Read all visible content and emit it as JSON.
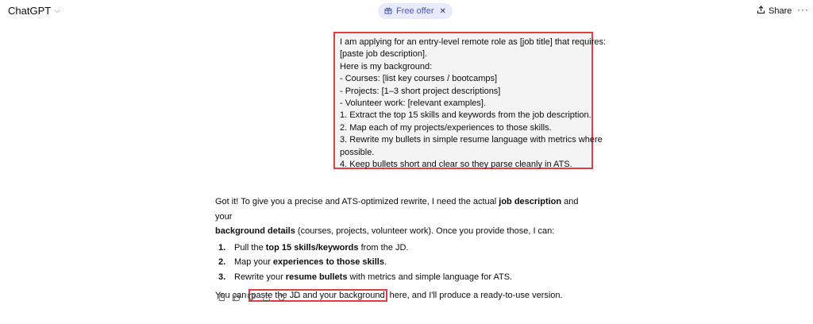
{
  "header": {
    "model_name": "ChatGPT",
    "offer_label": "Free offer",
    "share_label": "Share"
  },
  "user_message": {
    "lines": [
      "I am applying for an entry-level remote role as [job title] that requires:",
      "[paste job description].",
      "Here is my background:",
      "- Courses: [list key courses / bootcamps]",
      "- Projects: [1–3 short project descriptions]",
      "- Volunteer work: [relevant examples].",
      "1. Extract the top 15 skills and keywords from the job description.",
      "2. Map each of my projects/experiences to those skills.",
      "3. Rewrite my bullets in simple resume language with metrics where",
      "possible.",
      "4. Keep bullets short and clear so they parse cleanly in ATS."
    ]
  },
  "assistant": {
    "intro_1": "Got it! To give you a precise and ATS-optimized rewrite, I need the actual ",
    "intro_bold_1": "job description",
    "intro_2": " and your",
    "intro_bold_2": "background details",
    "intro_3": " (courses, projects, volunteer work). Once you provide those, I can:",
    "steps": [
      {
        "num": "1.",
        "pre": "Pull the ",
        "bold": "top 15 skills/keywords",
        "post": " from the JD."
      },
      {
        "num": "2.",
        "pre": "Map your ",
        "bold": "experiences to those skills",
        "post": "."
      },
      {
        "num": "3.",
        "pre": "Rewrite your ",
        "bold": "resume bullets",
        "post": " with metrics and simple language for ATS."
      }
    ],
    "final_pre": "You can ",
    "final_highlight": "paste the JD and your background",
    "final_post": " here, and I'll produce a ready-to-use version."
  },
  "icons": [
    "copy-icon",
    "thumbs-up-icon",
    "thumbs-down-icon",
    "share-icon",
    "regenerate-icon",
    "more-icon"
  ]
}
